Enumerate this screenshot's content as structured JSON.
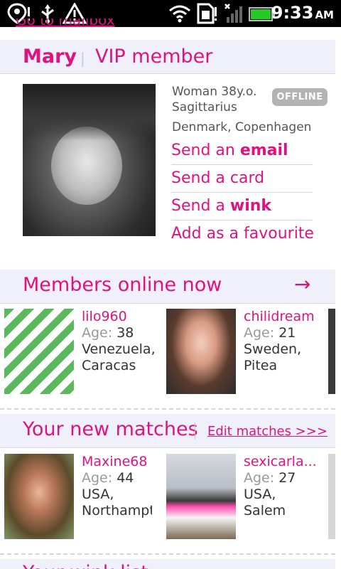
{
  "status_bar": {
    "icons": [
      "location-pin-icon",
      "usb-icon",
      "warning-icon",
      "wifi-icon",
      "sim-card-icon",
      "signal-off-icon",
      "battery-icon"
    ],
    "time": "9:33",
    "ampm": "AM",
    "battery_color": "#22cc22"
  },
  "top_link_partial": "Go to mailbox",
  "profile": {
    "name": "Mary",
    "membership": "VIP member",
    "status_badge": "OFFLINE",
    "details": {
      "gender_age": "Woman 38y.o.",
      "sign": "Sagittarius",
      "location": "Denmark, Copenhagen"
    },
    "actions": [
      {
        "prefix": "Send an ",
        "bold": "email"
      },
      {
        "prefix": "Send a card",
        "bold": ""
      },
      {
        "prefix": "Send a ",
        "bold": "wink"
      },
      {
        "prefix": "Add as a favourite",
        "bold": ""
      }
    ]
  },
  "members_online": {
    "title": "Members online now",
    "arrow": "→",
    "members": [
      {
        "name": "lilo960",
        "age_label": "Age:",
        "age": "38",
        "country": "Venezuela,",
        "city": "Caracas"
      },
      {
        "name": "chilidream",
        "age_label": "Age:",
        "age": "21",
        "country": "Sweden,",
        "city": "Pitea"
      }
    ]
  },
  "new_matches": {
    "title": "Your new matches",
    "edit_link": "Edit matches >>>",
    "members": [
      {
        "name": "Maxine68",
        "age_label": "Age:",
        "age": "44",
        "country": "USA,",
        "city": "Northampton"
      },
      {
        "name": "sexicarla...",
        "age_label": "Age:",
        "age": "27",
        "country": "USA,",
        "city": "Salem"
      }
    ]
  },
  "bottom_section_partial": "Your wink list",
  "colors": {
    "accent": "#e0127f",
    "header_bg": "#f0f0fa",
    "badge_bg": "#b3b3b3"
  }
}
